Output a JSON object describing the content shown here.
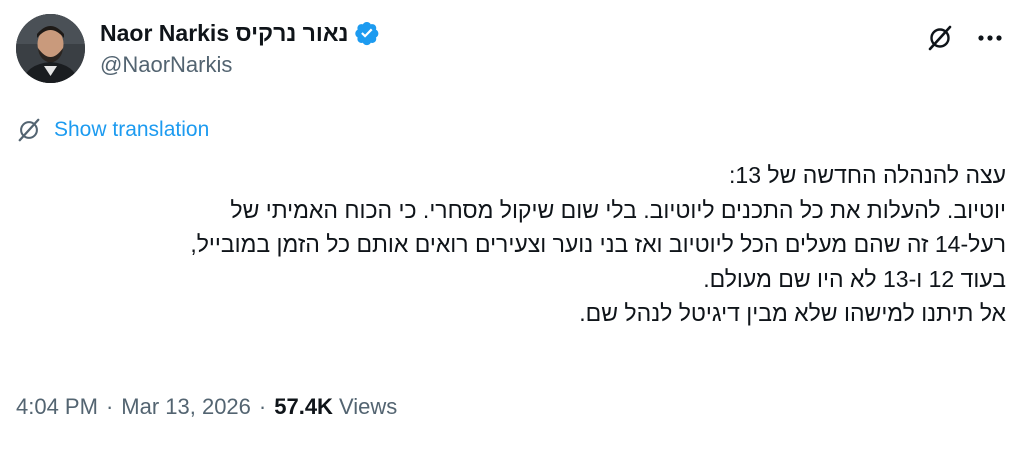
{
  "author": {
    "display_name": "Naor Narkis נאור נרקיס",
    "handle": "@NaorNarkis",
    "verified": true,
    "verified_color": "#1d9bf0"
  },
  "header_actions": {
    "grok_icon": "grok-icon",
    "more_icon": "more-horizontal-icon"
  },
  "translation": {
    "icon": "grok-icon",
    "label": "Show translation",
    "color": "#1d9bf0"
  },
  "tweet": {
    "lines": [
      "עצה להנהלה החדשה של 13:",
      "יוטיוב. להעלות את כל התכנים ליוטיוב. בלי שום שיקול מסחרי. כי הכוח האמיתי של",
      "רעל-14 זה שהם מעלים הכל ליוטיוב ואז בני נוער וצעירים רואים אותם כל הזמן במובייל,",
      "בעוד 12 ו-13 לא היו שם מעולם.",
      "אל תיתנו למישהו שלא מבין דיגיטל לנהל שם."
    ]
  },
  "meta": {
    "time": "4:04 PM",
    "separator": "·",
    "date": "Mar 13, 2026",
    "views_count": "57.4K",
    "views_label": "Views"
  },
  "colors": {
    "text_primary": "#0f1419",
    "text_secondary": "#536471",
    "accent": "#1d9bf0"
  }
}
